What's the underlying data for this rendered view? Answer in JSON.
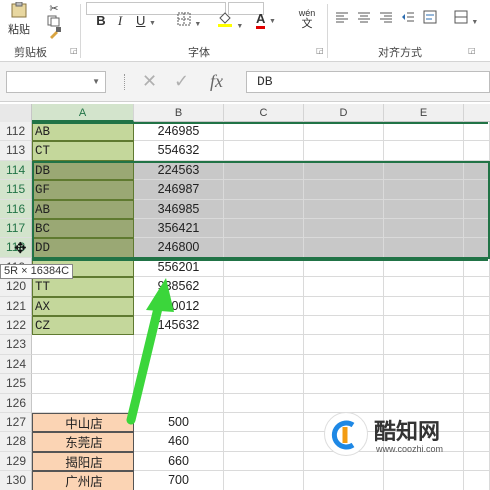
{
  "ribbon": {
    "paste_label": "粘贴",
    "clipboard_label": "剪贴板",
    "font_label": "字体",
    "alignment_label": "对齐方式",
    "bold": "B",
    "italic": "I",
    "underline": "U",
    "font_color_glyph": "A",
    "phonetic_glyph": "wén",
    "phonetic_sub": "文"
  },
  "formula_bar": {
    "name_box": "",
    "cancel_glyph": "✕",
    "enter_glyph": "✓",
    "fx_label": "fx",
    "formula": "DB"
  },
  "columns": [
    "A",
    "B",
    "C",
    "D",
    "E"
  ],
  "rows": [
    {
      "num": "112",
      "a": "AB",
      "b": "246985"
    },
    {
      "num": "113",
      "a": "CT",
      "b": "554632"
    },
    {
      "num": "114",
      "a": "DB",
      "b": "224563"
    },
    {
      "num": "115",
      "a": "GF",
      "b": "246987"
    },
    {
      "num": "116",
      "a": "AB",
      "b": "346985"
    },
    {
      "num": "117",
      "a": "BC",
      "b": "356421"
    },
    {
      "num": "118",
      "a": "DD",
      "b": "246800"
    },
    {
      "num": "119",
      "a": "",
      "b": "556201"
    },
    {
      "num": "120",
      "a": "TT",
      "b": "938562"
    },
    {
      "num": "121",
      "a": "AX",
      "b": "530012"
    },
    {
      "num": "122",
      "a": "CZ",
      "b": "145632"
    },
    {
      "num": "123",
      "a": "",
      "b": ""
    },
    {
      "num": "124",
      "a": "",
      "b": ""
    },
    {
      "num": "125",
      "a": "",
      "b": ""
    },
    {
      "num": "126",
      "a": "",
      "b": ""
    },
    {
      "num": "127",
      "a": "中山店",
      "b": "500"
    },
    {
      "num": "128",
      "a": "东莞店",
      "b": "460"
    },
    {
      "num": "129",
      "a": "揭阳店",
      "b": "660"
    },
    {
      "num": "130",
      "a": "广州店",
      "b": "700"
    }
  ],
  "tooltip": "5R × 16384C",
  "watermark": {
    "name": "酷知网",
    "url": "www.coozhi.com"
  },
  "colors": {
    "accent": "#217346",
    "cell_green": "#c4d79b",
    "cell_green_selected": "#9aa874",
    "store_fill": "#fbd4b4",
    "arrow_green": "#3bd63b"
  }
}
